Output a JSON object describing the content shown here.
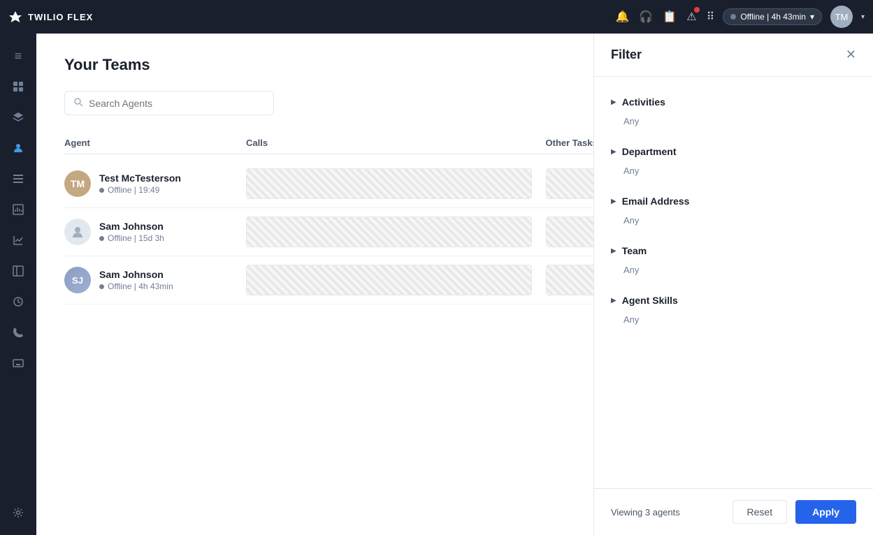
{
  "brand": {
    "name": "TWILIO FLEX",
    "logo": "✦"
  },
  "topbar": {
    "status_label": "Offline | 4h 43min",
    "status_dot_color": "#718096",
    "icons": [
      "🔔",
      "🎧",
      "📋",
      "⚠",
      "⠿"
    ],
    "avatar_initials": "TM"
  },
  "sidebar": {
    "items": [
      {
        "id": "menu",
        "icon": "≡",
        "active": false
      },
      {
        "id": "grid",
        "icon": "⊞",
        "active": false
      },
      {
        "id": "layers",
        "icon": "◧",
        "active": false
      },
      {
        "id": "users",
        "icon": "👤",
        "active": true
      },
      {
        "id": "list",
        "icon": "☰",
        "active": false
      },
      {
        "id": "chart",
        "icon": "📊",
        "active": false
      },
      {
        "id": "panel",
        "icon": "⬜",
        "active": false
      },
      {
        "id": "clock",
        "icon": "⏱",
        "active": false
      },
      {
        "id": "phone",
        "icon": "📞",
        "active": false
      },
      {
        "id": "keyboard",
        "icon": "⌨",
        "active": false
      },
      {
        "id": "settings",
        "icon": "⚙",
        "active": false
      }
    ]
  },
  "main": {
    "page_title": "Your Teams",
    "search_placeholder": "Search Agents",
    "table": {
      "columns": [
        "Agent",
        "Calls",
        "Other Tasks"
      ],
      "rows": [
        {
          "name": "Test McTesterson",
          "status": "Offline | 19:49",
          "avatar_type": "image",
          "avatar_initials": "TM"
        },
        {
          "name": "Sam Johnson",
          "status": "Offline | 15d 3h",
          "avatar_type": "placeholder"
        },
        {
          "name": "Sam Johnson",
          "status": "Offline | 4h 43min",
          "avatar_type": "image2",
          "avatar_initials": "SJ"
        }
      ]
    }
  },
  "filter": {
    "title": "Filter",
    "sections": [
      {
        "id": "activities",
        "label": "Activities",
        "value": "Any"
      },
      {
        "id": "department",
        "label": "Department",
        "value": "Any"
      },
      {
        "id": "email_address",
        "label": "Email Address",
        "value": "Any"
      },
      {
        "id": "team",
        "label": "Team",
        "value": "Any"
      },
      {
        "id": "agent_skills",
        "label": "Agent Skills",
        "value": "Any"
      }
    ],
    "footer": {
      "viewing_text": "Viewing 3 agents",
      "reset_label": "Reset",
      "apply_label": "Apply"
    }
  }
}
